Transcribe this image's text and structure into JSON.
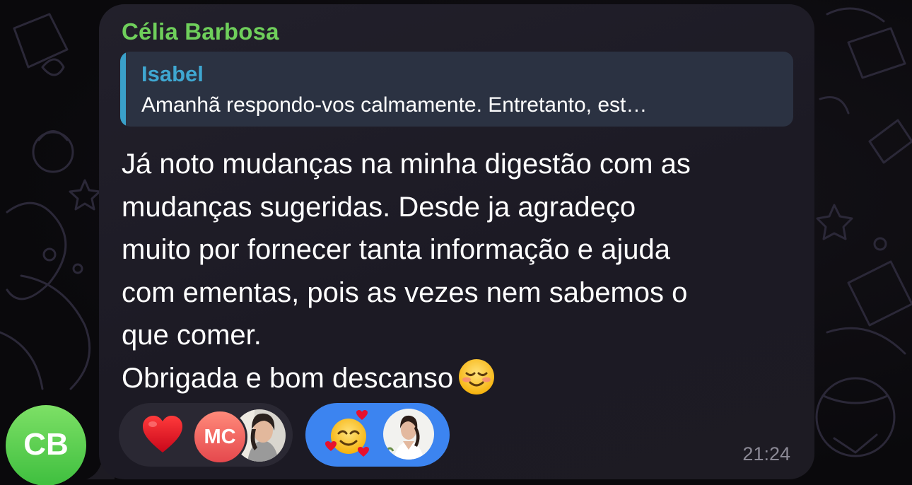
{
  "message": {
    "sender": "Célia Barbosa",
    "sender_color": "#6fcf5b",
    "reply": {
      "author": "Isabel",
      "preview": "Amanhã respondo-vos calmamente. Entretanto, est…",
      "accent_color": "#3aa0c9"
    },
    "lines": [
      "Já noto mudanças na minha digestão com as",
      "mudanças sugeridas. Desde ja agradeço",
      "muito por fornecer tanta informação e ajuda",
      "com ementas, pois as vezes nem sabemos o",
      "que comer.",
      "Obrigada e bom descanso"
    ],
    "trailing_emoji": "smiling-face-icon",
    "time": "21:24"
  },
  "reactions": [
    {
      "emoji": "red-heart-icon",
      "selected": false,
      "users": [
        {
          "initials": "MC",
          "avatar_type": "initials"
        },
        {
          "avatar_type": "photo"
        }
      ]
    },
    {
      "emoji": "smiling-face-with-hearts-icon",
      "selected": true,
      "users": [
        {
          "avatar_type": "photo"
        }
      ]
    }
  ],
  "author_avatar": {
    "initials": "CB",
    "color": "#5bd34f"
  }
}
